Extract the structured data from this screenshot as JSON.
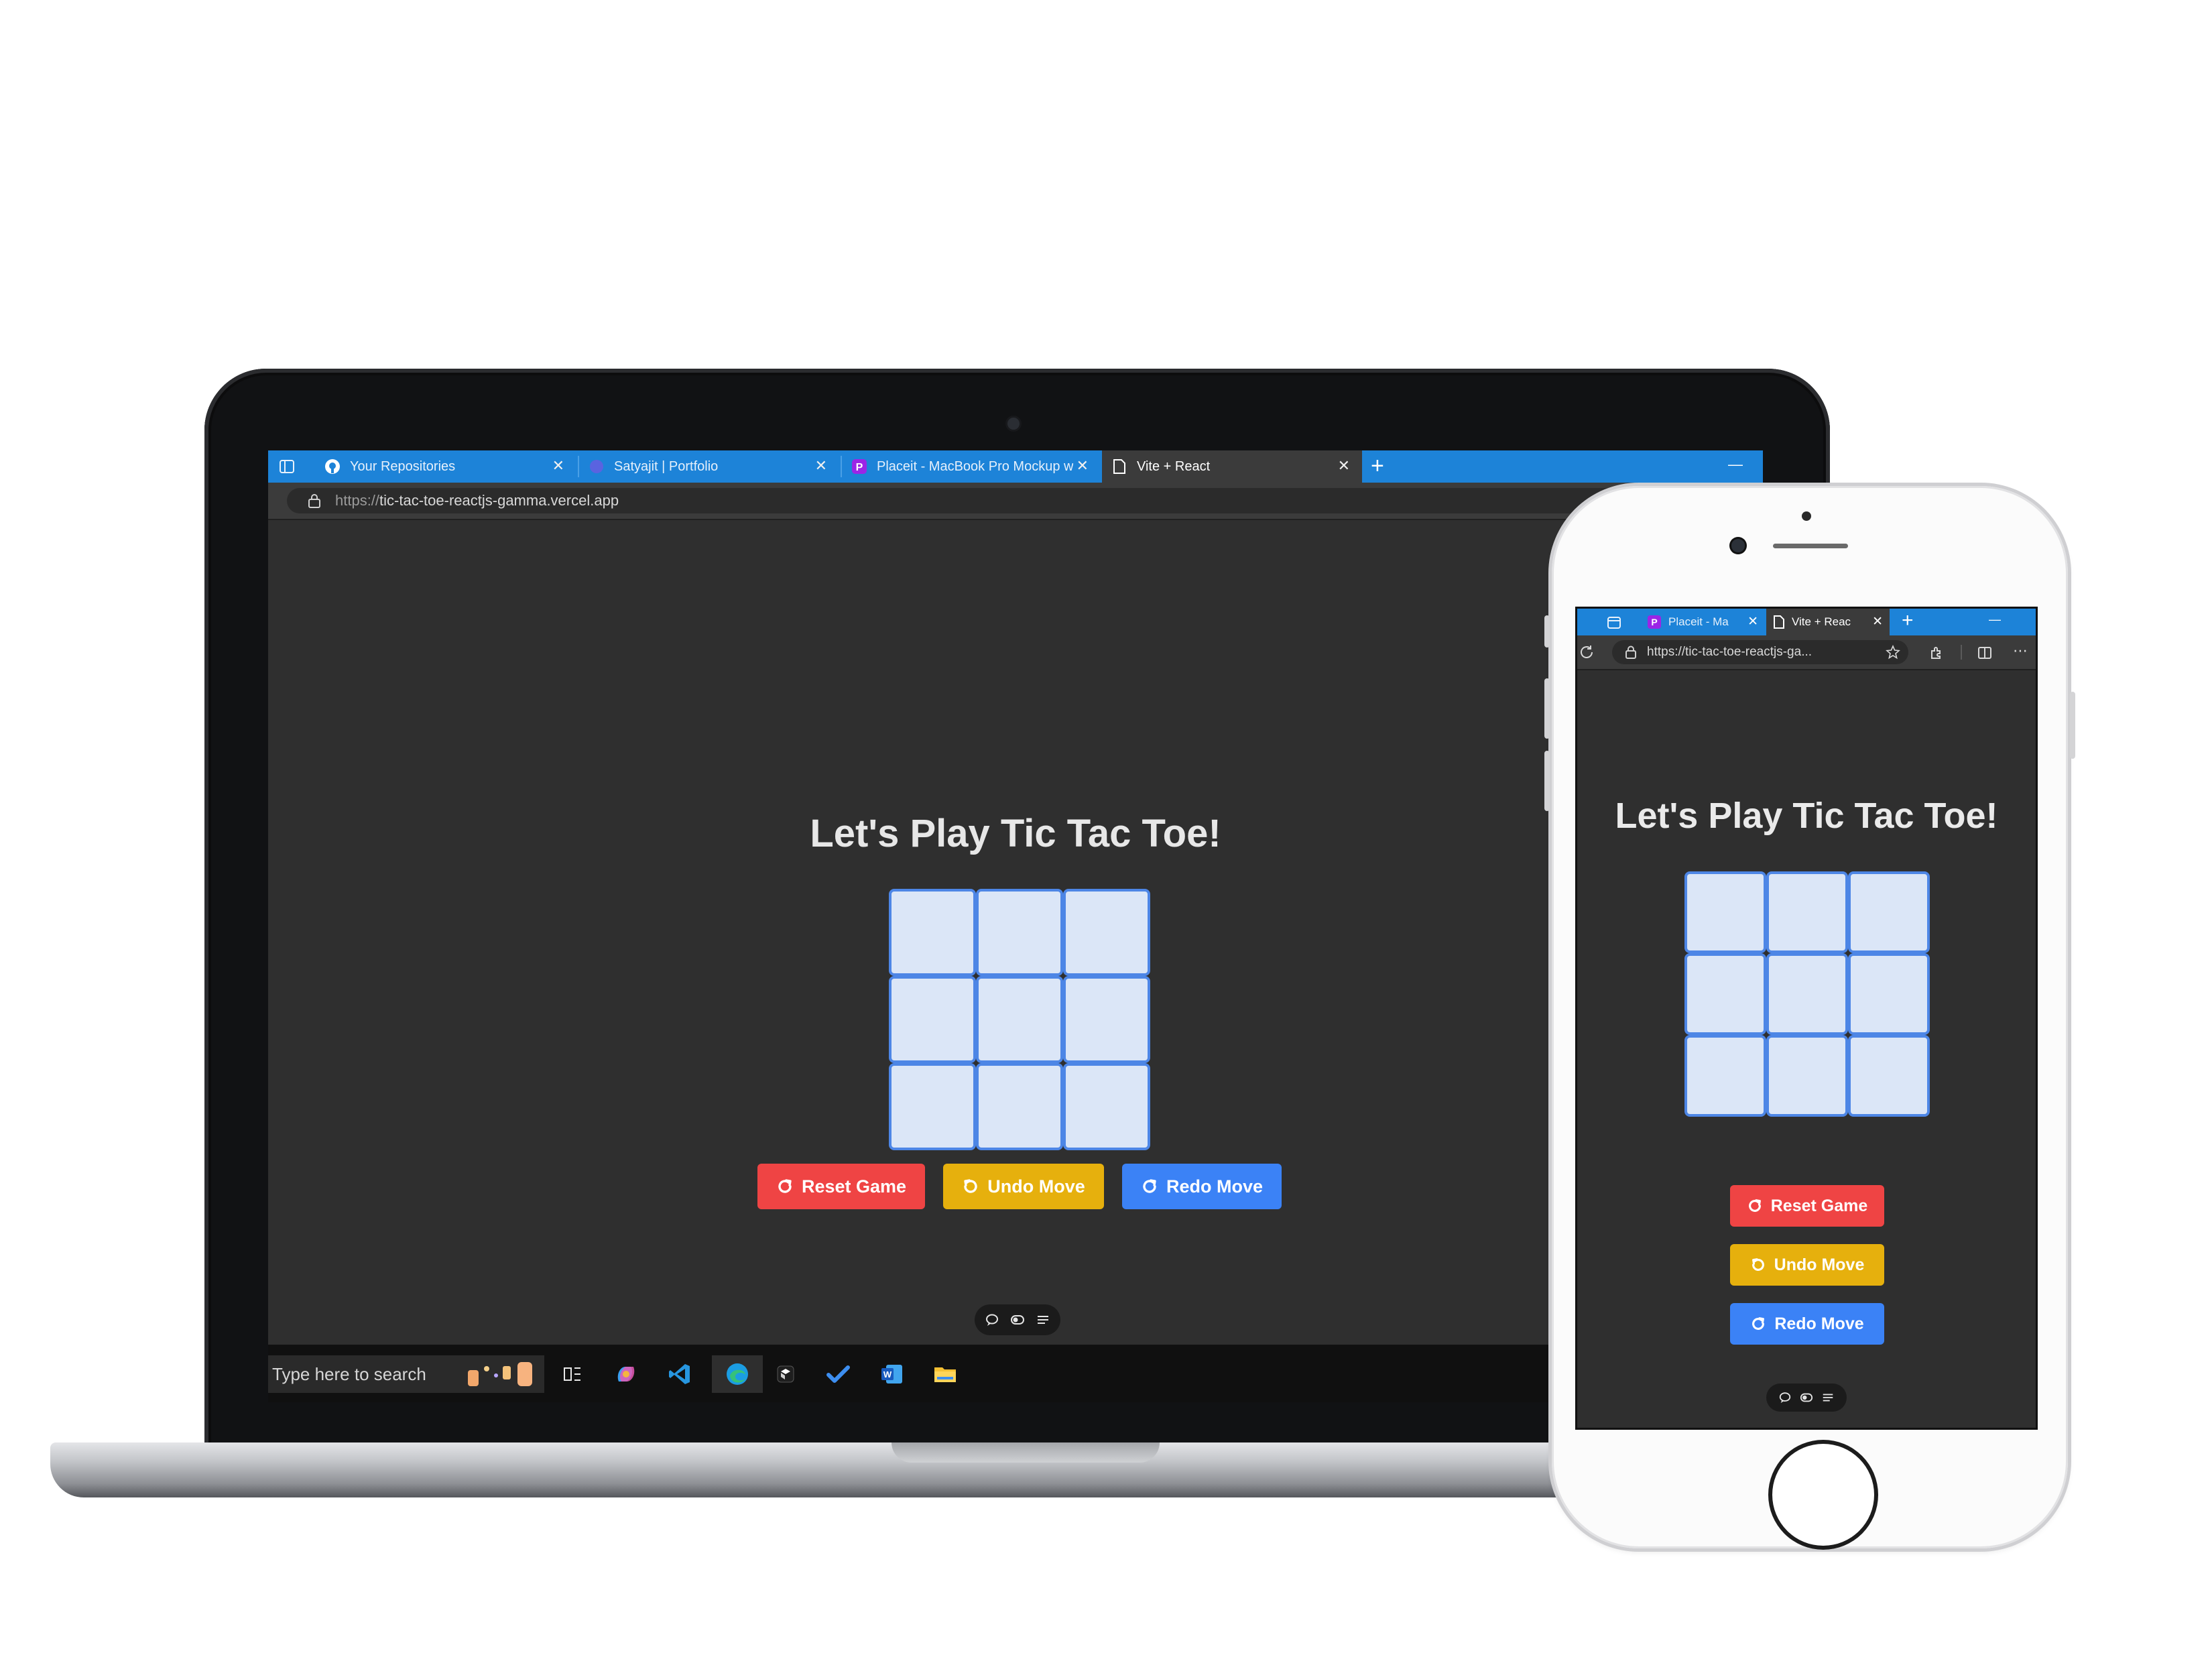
{
  "laptop": {
    "tabs": [
      {
        "label": "Your Repositories",
        "icon": "github-icon"
      },
      {
        "label": "Satyajit | Portfolio",
        "icon": "portfolio-icon"
      },
      {
        "label": "Placeit - MacBook Pro Mockup w",
        "icon": "placeit-icon"
      },
      {
        "label": "Vite + React",
        "icon": "page-icon"
      }
    ],
    "new_tab_symbol": "+",
    "minimize_symbol": "—",
    "address_prefix": "https://",
    "address_host": "tic-tac-toe-reactjs-gamma.vercel.app",
    "taskbar": {
      "search_placeholder": "Type here to search"
    }
  },
  "game": {
    "title": "Let's Play Tic Tac Toe!",
    "cells": [
      "",
      "",
      "",
      "",
      "",
      "",
      "",
      "",
      ""
    ],
    "buttons": {
      "reset": "Reset Game",
      "undo": "Undo Move",
      "redo": "Redo Move"
    }
  },
  "phone": {
    "tabs": [
      {
        "label": "Placeit - Ma",
        "icon": "placeit-icon"
      },
      {
        "label": "Vite + Reac",
        "icon": "page-icon"
      }
    ],
    "new_tab_symbol": "+",
    "minimize_symbol": "—",
    "address_text": "https://tic-tac-toe-reactjs-ga..."
  },
  "colors": {
    "page_bg": "#2f2f2f",
    "cell_fill": "#dbe6f7",
    "cell_border": "#4d86e6",
    "reset": "#ef4444",
    "undo": "#e6b00d",
    "redo": "#3b82f6",
    "browser_tabbar": "#1d83d8"
  }
}
